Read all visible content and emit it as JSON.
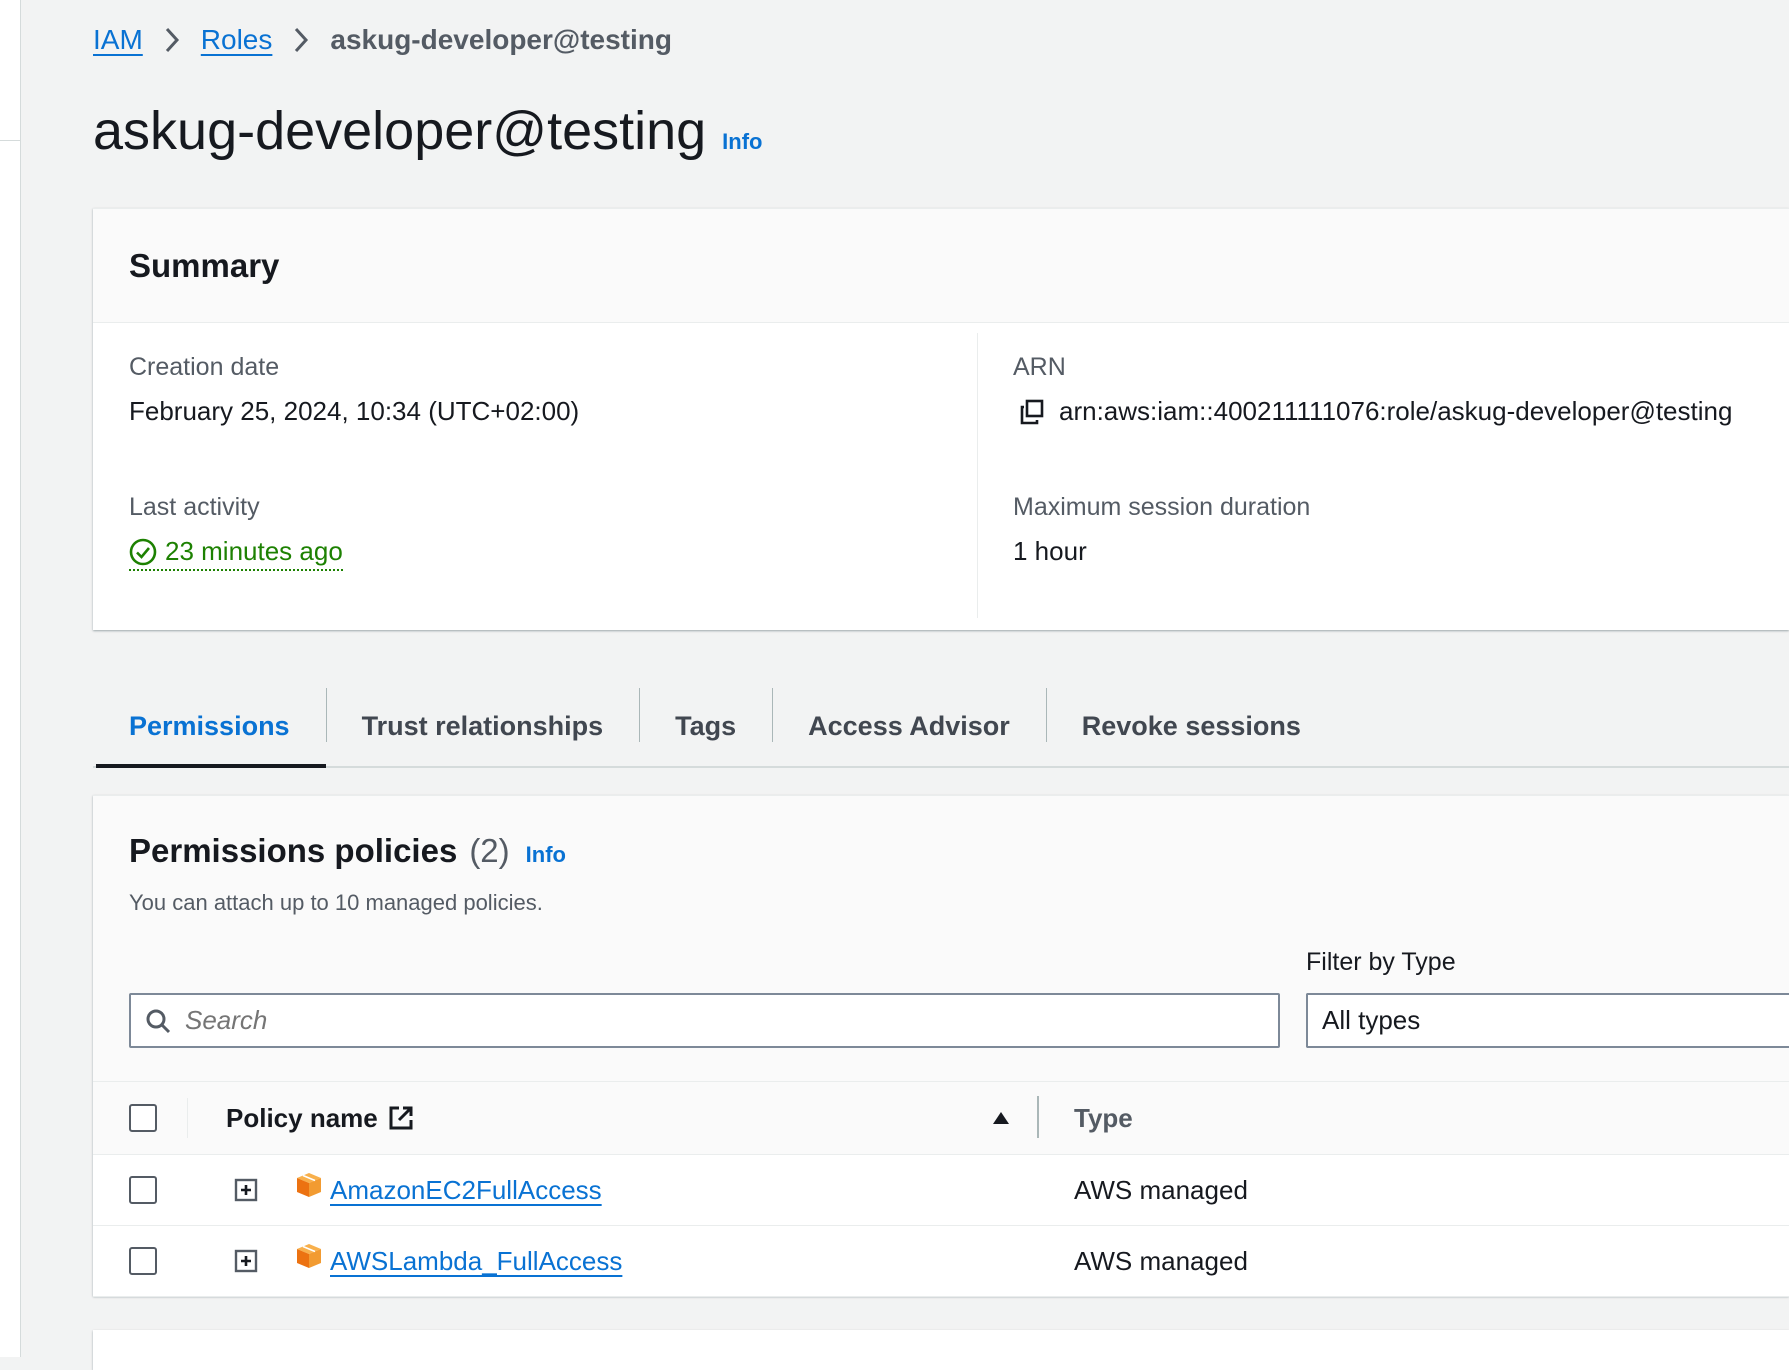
{
  "breadcrumb": {
    "items": [
      "IAM",
      "Roles"
    ],
    "current": "askug-developer@testing"
  },
  "page": {
    "title": "askug-developer@testing",
    "info_label": "Info"
  },
  "summary": {
    "title": "Summary",
    "creation_date_label": "Creation date",
    "creation_date_value": "February 25, 2024, 10:34 (UTC+02:00)",
    "arn_label": "ARN",
    "arn_value": "arn:aws:iam::400211111076:role/askug-developer@testing",
    "last_activity_label": "Last activity",
    "last_activity_value": "23 minutes ago",
    "max_session_label": "Maximum session duration",
    "max_session_value": "1 hour"
  },
  "tabs": [
    {
      "label": "Permissions",
      "active": true
    },
    {
      "label": "Trust relationships",
      "active": false
    },
    {
      "label": "Tags",
      "active": false
    },
    {
      "label": "Access Advisor",
      "active": false
    },
    {
      "label": "Revoke sessions",
      "active": false
    }
  ],
  "permissions": {
    "title": "Permissions policies",
    "count": "(2)",
    "info_label": "Info",
    "description": "You can attach up to 10 managed policies.",
    "filter_label": "Filter by Type",
    "search_placeholder": "Search",
    "filter_value": "All types",
    "columns": {
      "policy_name": "Policy name",
      "type": "Type"
    },
    "rows": [
      {
        "name": "AmazonEC2FullAccess",
        "type": "AWS managed"
      },
      {
        "name": "AWSLambda_FullAccess",
        "type": "AWS managed"
      }
    ]
  },
  "colors": {
    "link": "#0972d3",
    "success": "#1d8102",
    "package_orange": "#ec7211"
  },
  "icons": {
    "copy": "copy-icon",
    "status": "check-circle-icon",
    "search": "search-icon",
    "external": "external-link-icon",
    "sort": "sort-up-icon",
    "expand": "expand-plus-icon",
    "package": "package-icon"
  }
}
